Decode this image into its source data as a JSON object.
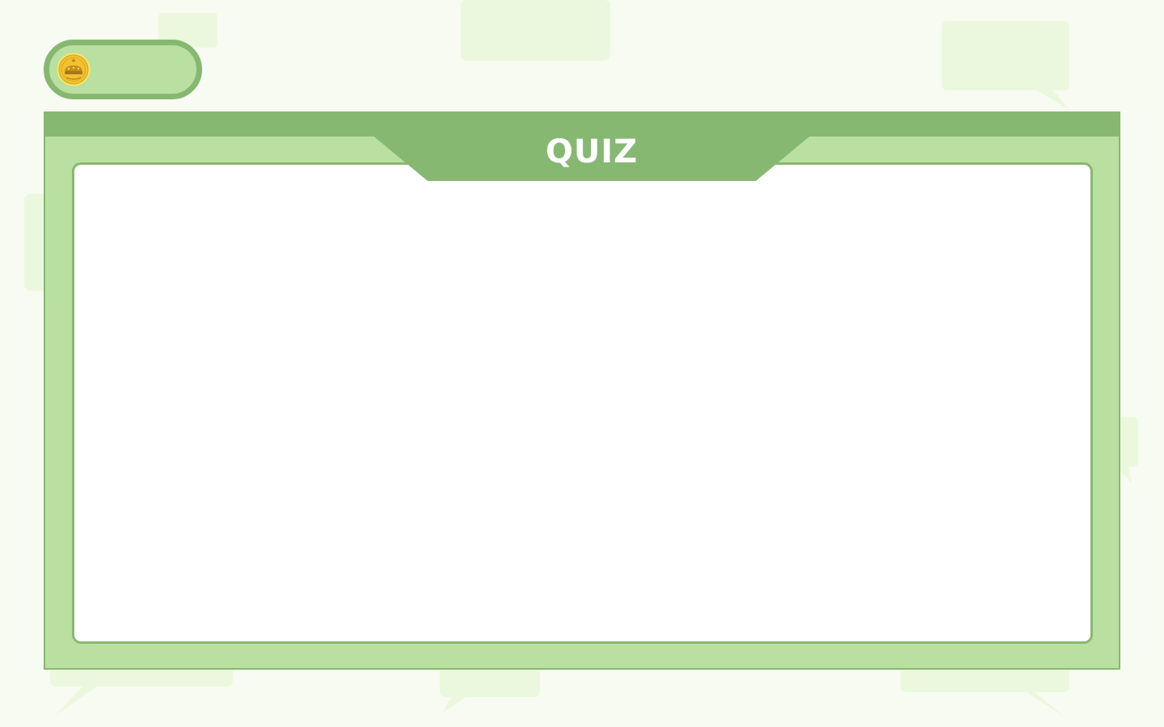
{
  "background": {
    "color": "#f7fbf1",
    "bubble_color": "#ecf8de"
  },
  "coin_pill": {
    "icon": "coin-icon",
    "coin_color": "#f2c230"
  },
  "quiz": {
    "title": "QUIZ",
    "frame_color": "#b9e0a1",
    "accent_color": "#86b872",
    "content_color": "#ffffff"
  }
}
